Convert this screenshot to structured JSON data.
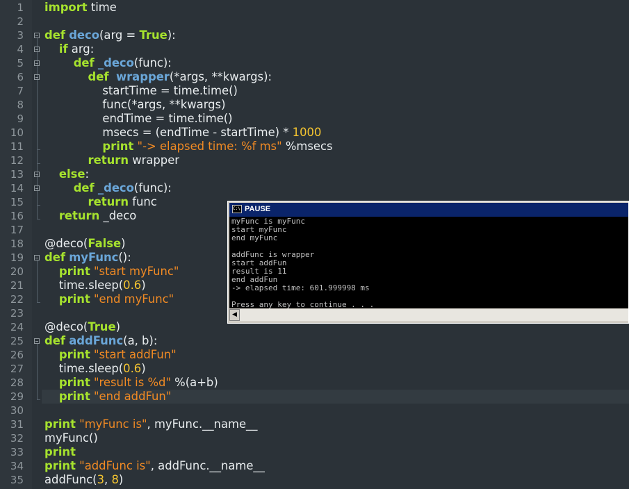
{
  "editor": {
    "lines": [
      {
        "n": "1",
        "tokens": [
          [
            "kw",
            "import"
          ],
          [
            "t",
            " time"
          ]
        ]
      },
      {
        "n": "2",
        "tokens": []
      },
      {
        "n": "3",
        "tokens": [
          [
            "kw",
            "def"
          ],
          [
            "t",
            " "
          ],
          [
            "fn",
            "deco"
          ],
          [
            "t",
            "(arg = "
          ],
          [
            "kw",
            "True"
          ],
          [
            "t",
            "):"
          ]
        ]
      },
      {
        "n": "4",
        "tokens": [
          [
            "t",
            "    "
          ],
          [
            "kw",
            "if"
          ],
          [
            "t",
            " arg:"
          ]
        ]
      },
      {
        "n": "5",
        "tokens": [
          [
            "t",
            "        "
          ],
          [
            "kw",
            "def"
          ],
          [
            "t",
            " "
          ],
          [
            "fn",
            "_deco"
          ],
          [
            "t",
            "(func):"
          ]
        ]
      },
      {
        "n": "6",
        "tokens": [
          [
            "t",
            "            "
          ],
          [
            "kw",
            "def"
          ],
          [
            "t",
            "  "
          ],
          [
            "fn",
            "wrapper"
          ],
          [
            "t",
            "(*args, **kwargs):"
          ]
        ]
      },
      {
        "n": "7",
        "tokens": [
          [
            "t",
            "                startTime = time.time()"
          ]
        ]
      },
      {
        "n": "8",
        "tokens": [
          [
            "t",
            "                func(*args, **kwargs)"
          ]
        ]
      },
      {
        "n": "9",
        "tokens": [
          [
            "t",
            "                endTime = time.time()"
          ]
        ]
      },
      {
        "n": "10",
        "tokens": [
          [
            "t",
            "                msecs = (endTime - startTime) * "
          ],
          [
            "num",
            "1000"
          ]
        ]
      },
      {
        "n": "11",
        "tokens": [
          [
            "t",
            "                "
          ],
          [
            "kw",
            "print"
          ],
          [
            "t",
            " "
          ],
          [
            "str",
            "\"-> elapsed time: %f ms\""
          ],
          [
            "t",
            " %msecs"
          ]
        ]
      },
      {
        "n": "12",
        "tokens": [
          [
            "t",
            "            "
          ],
          [
            "kw",
            "return"
          ],
          [
            "t",
            " wrapper"
          ]
        ]
      },
      {
        "n": "13",
        "tokens": [
          [
            "t",
            "    "
          ],
          [
            "kw",
            "else"
          ],
          [
            "t",
            ":"
          ]
        ]
      },
      {
        "n": "14",
        "tokens": [
          [
            "t",
            "        "
          ],
          [
            "kw",
            "def"
          ],
          [
            "t",
            " "
          ],
          [
            "fn",
            "_deco"
          ],
          [
            "t",
            "(func):"
          ]
        ]
      },
      {
        "n": "15",
        "tokens": [
          [
            "t",
            "            "
          ],
          [
            "kw",
            "return"
          ],
          [
            "t",
            " func"
          ]
        ]
      },
      {
        "n": "16",
        "tokens": [
          [
            "t",
            "    "
          ],
          [
            "kw",
            "return"
          ],
          [
            "t",
            " _deco"
          ]
        ]
      },
      {
        "n": "17",
        "tokens": []
      },
      {
        "n": "18",
        "tokens": [
          [
            "t",
            "@deco("
          ],
          [
            "kw",
            "False"
          ],
          [
            "t",
            ")"
          ]
        ]
      },
      {
        "n": "19",
        "tokens": [
          [
            "kw",
            "def"
          ],
          [
            "t",
            " "
          ],
          [
            "fn",
            "myFunc"
          ],
          [
            "t",
            "():"
          ]
        ]
      },
      {
        "n": "20",
        "tokens": [
          [
            "t",
            "    "
          ],
          [
            "kw",
            "print"
          ],
          [
            "t",
            " "
          ],
          [
            "str",
            "\"start myFunc\""
          ]
        ]
      },
      {
        "n": "21",
        "tokens": [
          [
            "t",
            "    time.sleep("
          ],
          [
            "num",
            "0.6"
          ],
          [
            "t",
            ")"
          ]
        ]
      },
      {
        "n": "22",
        "tokens": [
          [
            "t",
            "    "
          ],
          [
            "kw",
            "print"
          ],
          [
            "t",
            " "
          ],
          [
            "str",
            "\"end myFunc\""
          ]
        ]
      },
      {
        "n": "23",
        "tokens": []
      },
      {
        "n": "24",
        "tokens": [
          [
            "t",
            "@deco("
          ],
          [
            "kw",
            "True"
          ],
          [
            "t",
            ")"
          ]
        ]
      },
      {
        "n": "25",
        "tokens": [
          [
            "kw",
            "def"
          ],
          [
            "t",
            " "
          ],
          [
            "fn",
            "addFunc"
          ],
          [
            "t",
            "(a, b):"
          ]
        ]
      },
      {
        "n": "26",
        "tokens": [
          [
            "t",
            "    "
          ],
          [
            "kw",
            "print"
          ],
          [
            "t",
            " "
          ],
          [
            "str",
            "\"start addFun\""
          ]
        ]
      },
      {
        "n": "27",
        "tokens": [
          [
            "t",
            "    time.sleep("
          ],
          [
            "num",
            "0.6"
          ],
          [
            "t",
            ")"
          ]
        ]
      },
      {
        "n": "28",
        "tokens": [
          [
            "t",
            "    "
          ],
          [
            "kw",
            "print"
          ],
          [
            "t",
            " "
          ],
          [
            "str",
            "\"result is %d\""
          ],
          [
            "t",
            " %(a+b)"
          ]
        ]
      },
      {
        "n": "29",
        "tokens": [
          [
            "t",
            "    "
          ],
          [
            "kw",
            "print"
          ],
          [
            "t",
            " "
          ],
          [
            "str",
            "\"end addFun\""
          ]
        ]
      },
      {
        "n": "30",
        "tokens": []
      },
      {
        "n": "31",
        "tokens": [
          [
            "kw",
            "print"
          ],
          [
            "t",
            " "
          ],
          [
            "str",
            "\"myFunc is\""
          ],
          [
            "t",
            ", myFunc.__name__"
          ]
        ]
      },
      {
        "n": "32",
        "tokens": [
          [
            "t",
            "myFunc()"
          ]
        ]
      },
      {
        "n": "33",
        "tokens": [
          [
            "kw",
            "print"
          ]
        ]
      },
      {
        "n": "34",
        "tokens": [
          [
            "kw",
            "print"
          ],
          [
            "t",
            " "
          ],
          [
            "str",
            "\"addFunc is\""
          ],
          [
            "t",
            ", addFunc.__name__"
          ]
        ]
      },
      {
        "n": "35",
        "tokens": [
          [
            "t",
            "addFunc("
          ],
          [
            "num",
            "3"
          ],
          [
            "t",
            ", "
          ],
          [
            "num",
            "8"
          ],
          [
            "t",
            ")"
          ]
        ]
      }
    ],
    "current_line": "29"
  },
  "console": {
    "title": "PAUSE",
    "icon": "cmd-icon",
    "icon_text": "C:\\",
    "output": [
      "myFunc is myFunc",
      "start myFunc",
      "end myFunc",
      "",
      "addFunc is wrapper",
      "start addFun",
      "result is 11",
      "end addFun",
      "-> elapsed time: 601.999998 ms",
      "",
      "Press any key to continue . . ."
    ],
    "scroll_left_glyph": "◀"
  },
  "colors": {
    "keyword": "#a6e22e",
    "function_name": "#6aa6d8",
    "string": "#f08a24",
    "number": "#f4c430",
    "editor_bg": "#2b3238",
    "console_title_bg": "#0a246a"
  }
}
